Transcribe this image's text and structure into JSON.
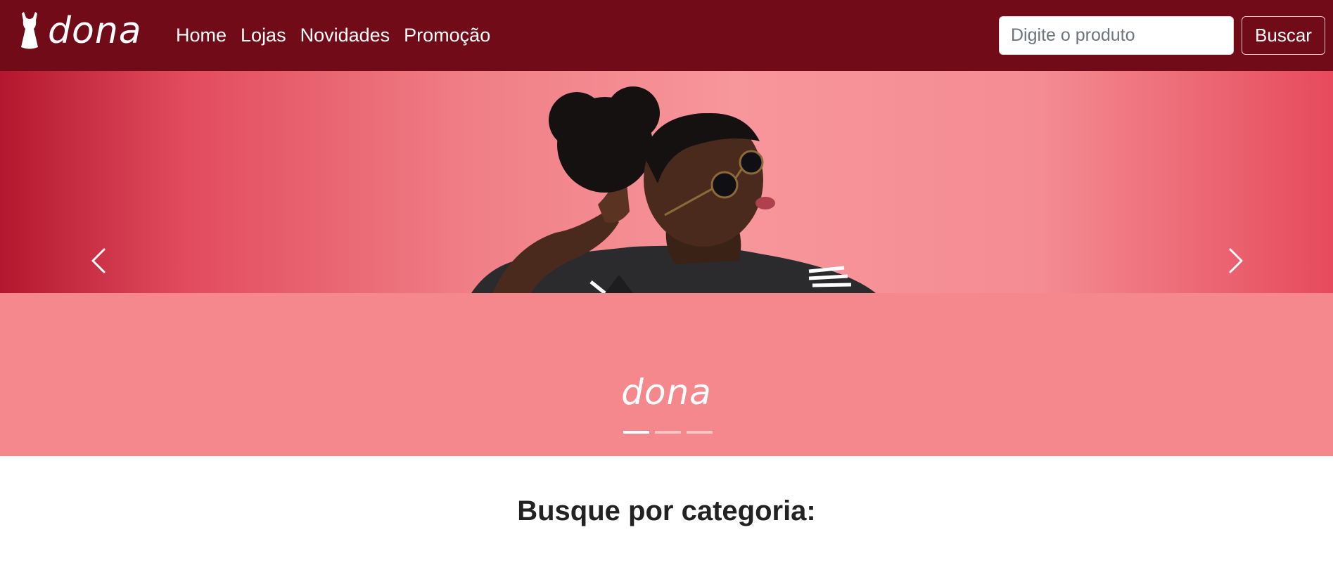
{
  "brand": {
    "name": "dona",
    "icon": "dress-icon"
  },
  "nav": {
    "items": [
      {
        "label": "Home"
      },
      {
        "label": "Lojas"
      },
      {
        "label": "Novidades"
      },
      {
        "label": "Promoção"
      }
    ]
  },
  "search": {
    "placeholder": "Digite o produto",
    "button_label": "Buscar"
  },
  "carousel": {
    "caption": "dona",
    "slide_count": 3,
    "active_index": 0,
    "prev_icon": "chevron-left-icon",
    "next_icon": "chevron-right-icon"
  },
  "section": {
    "heading": "Busque por categoria:"
  },
  "colors": {
    "navbar": "#720b18",
    "caption_band": "#f4888d",
    "hero_accent": "#e24b5e"
  }
}
